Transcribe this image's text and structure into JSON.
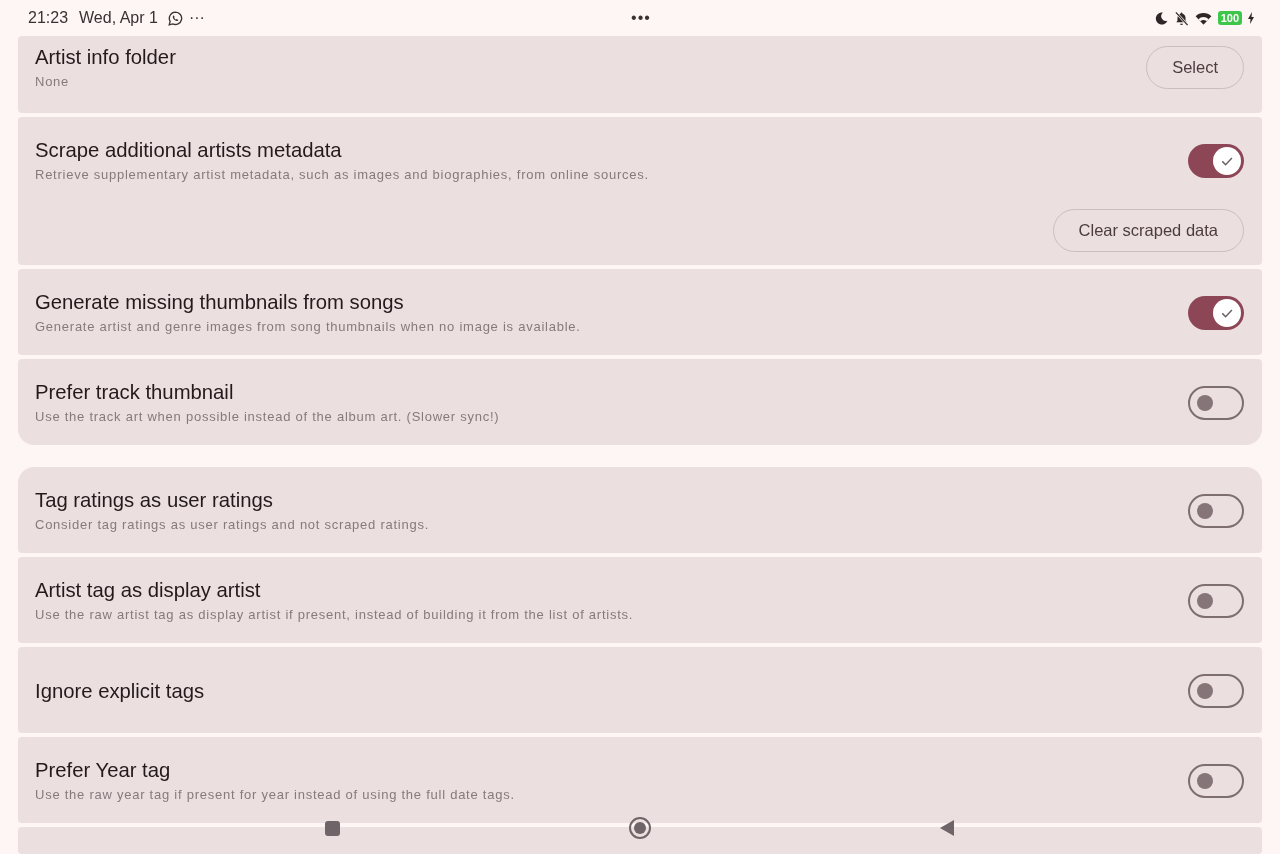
{
  "status_bar": {
    "time": "21:23",
    "date": "Wed, Apr 1",
    "notification_more": "···",
    "center_menu": "•••",
    "battery": "100",
    "charging": true
  },
  "groups": [
    {
      "items": [
        {
          "kind": "button",
          "title": "Artist info folder",
          "subtitle": "None",
          "button": "Select"
        },
        {
          "kind": "toggle",
          "title": "Scrape additional artists metadata",
          "subtitle": "Retrieve supplementary artist metadata, such as images and biographies, from online sources.",
          "on": true,
          "action": "Clear scraped data"
        },
        {
          "kind": "toggle",
          "title": "Generate missing thumbnails from songs",
          "subtitle": "Generate artist and genre images from song thumbnails when no image is available.",
          "on": true
        },
        {
          "kind": "toggle",
          "title": "Prefer track thumbnail",
          "subtitle": "Use the track art when possible instead of the album art. (Slower sync!)",
          "on": false
        }
      ]
    },
    {
      "items": [
        {
          "kind": "toggle",
          "title": "Tag ratings as user ratings",
          "subtitle": "Consider tag ratings as user ratings and not scraped ratings.",
          "on": false
        },
        {
          "kind": "toggle",
          "title": "Artist tag as display artist",
          "subtitle": "Use the raw artist tag as display artist if present, instead of building it from the list of artists.",
          "on": false
        },
        {
          "kind": "toggle",
          "title": "Ignore explicit tags",
          "on": false
        },
        {
          "kind": "toggle",
          "title": "Prefer Year tag",
          "subtitle": "Use the raw year tag if present for year instead of using the full date tags.",
          "on": false
        },
        {
          "kind": "cut_off"
        }
      ]
    }
  ]
}
